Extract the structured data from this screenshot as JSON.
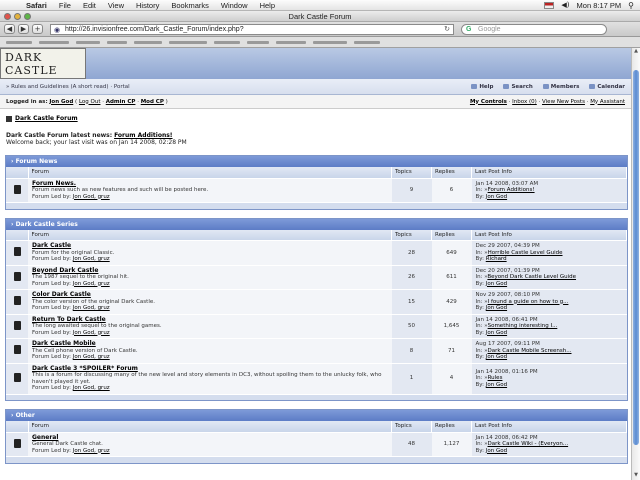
{
  "menubar": {
    "app": "Safari",
    "items": [
      "File",
      "Edit",
      "View",
      "History",
      "Bookmarks",
      "Window",
      "Help"
    ],
    "clock": "Mon 8:17 PM"
  },
  "window": {
    "title": "Dark Castle Forum"
  },
  "toolbar": {
    "back": "◀",
    "forward": "▶",
    "add": "+",
    "url": "http://26.invisionfree.com/Dark_Castle_Forum/index.php?",
    "search_placeholder": "Google"
  },
  "banner": {
    "logo_line1": "DARK",
    "logo_line2": "CASTLE"
  },
  "nav": {
    "rules": "Rules and Guidelines (A short read)",
    "portal": "Portal",
    "help": "Help",
    "search": "Search",
    "members": "Members",
    "calendar": "Calendar"
  },
  "userbar": {
    "logged_in_as": "Logged in as:",
    "user": "Jon God",
    "logout": "Log Out",
    "admin_cp": "Admin CP",
    "mod_cp": "Mod CP",
    "my_controls": "My Controls",
    "inbox": "Inbox (0)",
    "new_posts": "View New Posts",
    "assistant": "My Assistant"
  },
  "breadcrumb": "Dark Castle Forum",
  "news": {
    "label": "Dark Castle Forum latest news:",
    "link": "Forum Additions!",
    "welcome": "Welcome back; your last visit was on Jan 14 2008, 02:28 PM"
  },
  "columns": {
    "forum": "Forum",
    "topics": "Topics",
    "replies": "Replies",
    "last": "Last Post Info"
  },
  "categories": [
    {
      "title": "Forum News",
      "forums": [
        {
          "name": "Forum News.",
          "desc": "Forum news such as new features and such will be posted here.",
          "led": "Forum Led by:",
          "mods": "Jon God, gruz",
          "topics": "9",
          "replies": "6",
          "date": "Jan 14 2008, 03:07 AM",
          "in": "In:",
          "thread": "Forum Additions!",
          "by": "By:",
          "author": "Jon God"
        }
      ]
    },
    {
      "title": "Dark Castle Series",
      "forums": [
        {
          "name": "Dark Castle",
          "desc": "Forum for the original Classic.",
          "led": "Forum Led by:",
          "mods": "Jon God, gruz",
          "topics": "28",
          "replies": "649",
          "date": "Dec 29 2007, 04:39 PM",
          "in": "In:",
          "thread": "Horrible Castle Level Guide",
          "by": "By:",
          "author": "Richard"
        },
        {
          "name": "Beyond Dark Castle",
          "desc": "The 1987 sequel to the original hit.",
          "led": "Forum Led by:",
          "mods": "Jon God, gruz",
          "topics": "26",
          "replies": "611",
          "date": "Dec 20 2007, 01:39 PM",
          "in": "In:",
          "thread": "Beyond Dark Castle Level Guide",
          "by": "By:",
          "author": "Jon God"
        },
        {
          "name": "Color Dark Castle",
          "desc": "The color version of the original Dark Castle.",
          "led": "Forum Led by:",
          "mods": "Jon God, gruz",
          "topics": "15",
          "replies": "429",
          "date": "Nov 29 2007, 08:10 PM",
          "in": "In:",
          "thread": "I found a guide on how to g...",
          "by": "By:",
          "author": "Jon God"
        },
        {
          "name": "Return To Dark Castle",
          "desc": "The long awaited sequel to the original games.",
          "led": "Forum Led by:",
          "mods": "Jon God, gruz",
          "topics": "50",
          "replies": "1,645",
          "date": "Jan 14 2008, 06:41 PM",
          "in": "In:",
          "thread": "Something interesting I...",
          "by": "By:",
          "author": "Jon God"
        },
        {
          "name": "Dark Castle Mobile",
          "desc": "The Cell phone version of Dark Castle.",
          "led": "Forum Led by:",
          "mods": "Jon God, gruz",
          "topics": "8",
          "replies": "71",
          "date": "Aug 17 2007, 09:11 PM",
          "in": "In:",
          "thread": "Dark Castle Mobile Screensh...",
          "by": "By:",
          "author": "Jon God"
        },
        {
          "name": "Dark Castle 3 *SPOILER* Forum",
          "desc": "This is a forum for discussing many of the new level and story elements in DC3, without spoiling them to the unlucky folk, who haven't played it yet.",
          "led": "Forum Led by:",
          "mods": "Jon God, gruz",
          "topics": "1",
          "replies": "4",
          "date": "Jan 14 2008, 01:16 PM",
          "in": "In:",
          "thread": "Rules",
          "by": "By:",
          "author": "Jon God"
        }
      ]
    },
    {
      "title": "Other",
      "forums": [
        {
          "name": "General",
          "desc": "General Dark Castle chat.",
          "led": "Forum Led by:",
          "mods": "Jon God, gruz",
          "topics": "48",
          "replies": "1,127",
          "date": "Jan 14 2008, 06:42 PM",
          "in": "In:",
          "thread": "Dark Castle Wiki - (Everyon...",
          "by": "By:",
          "author": "Jon God"
        }
      ]
    }
  ]
}
